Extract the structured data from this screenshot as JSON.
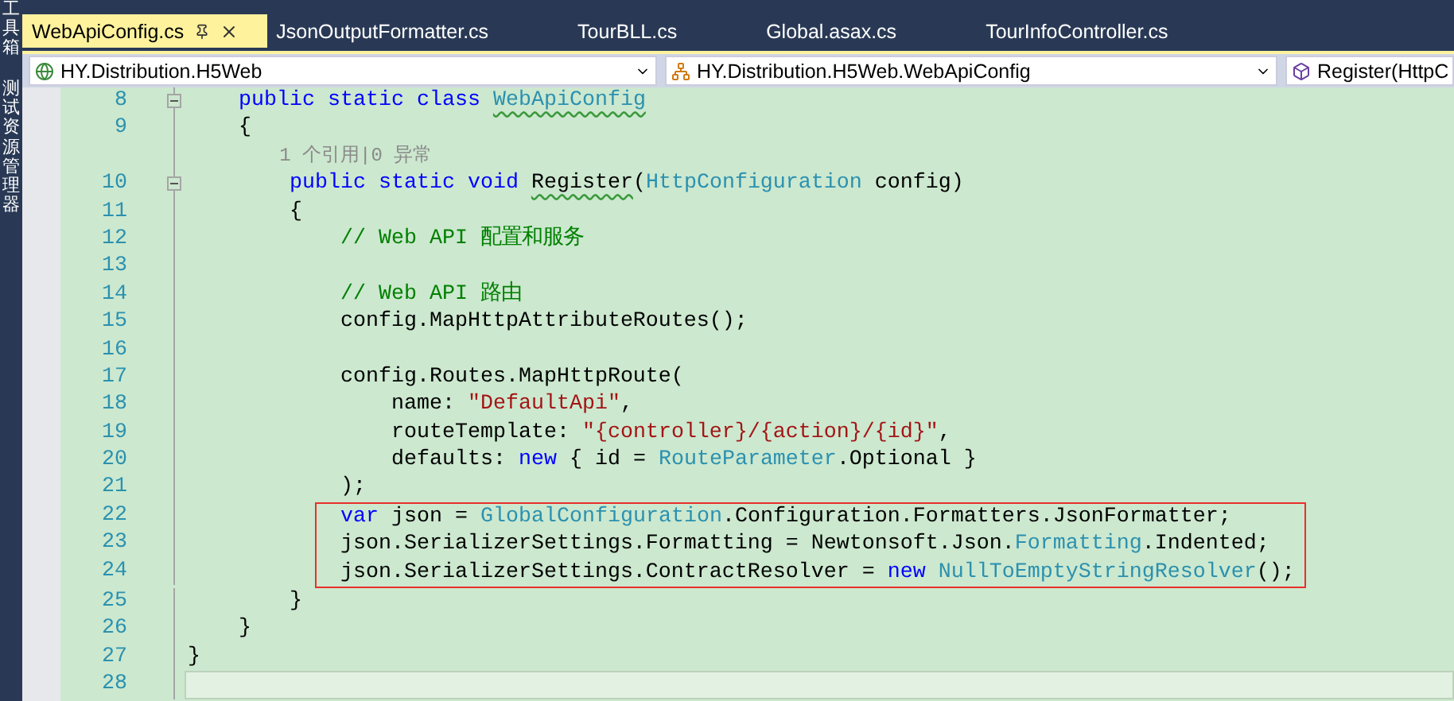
{
  "side_panel": {
    "tabs": [
      {
        "label": "工具箱"
      },
      {
        "label": "测试资源管理器"
      }
    ]
  },
  "tabs": [
    {
      "label": "WebApiConfig.cs",
      "selected": true
    },
    {
      "label": "JsonOutputFormatter.cs",
      "selected": false
    },
    {
      "label": "TourBLL.cs",
      "selected": false
    },
    {
      "label": "Global.asax.cs",
      "selected": false
    },
    {
      "label": "TourInfoController.cs",
      "selected": false
    }
  ],
  "navigation_bar": {
    "project": "HY.Distribution.H5Web",
    "type": "HY.Distribution.H5Web.WebApiConfig",
    "member": "Register(HttpC"
  },
  "editor": {
    "lines": [
      {
        "kind": "code",
        "number": "8",
        "foldable": true,
        "highlighted": false,
        "tokens": [
          {
            "kind": "keyword",
            "text": "    public static class "
          },
          {
            "kind": "type",
            "text": "WebApiConfig",
            "squiggly": true
          }
        ]
      },
      {
        "kind": "code",
        "number": "9",
        "foldable": false,
        "highlighted": false,
        "tokens": [
          {
            "kind": "plain",
            "text": "    {"
          }
        ]
      },
      {
        "kind": "codelens",
        "text": "        1 个引用|0 异常"
      },
      {
        "kind": "code",
        "number": "10",
        "foldable": true,
        "highlighted": false,
        "tokens": [
          {
            "kind": "keyword",
            "text": "        public static void "
          },
          {
            "kind": "plain",
            "text": "Register",
            "squiggly": true
          },
          {
            "kind": "plain",
            "text": "("
          },
          {
            "kind": "type",
            "text": "HttpConfiguration"
          },
          {
            "kind": "plain",
            "text": " config)"
          }
        ]
      },
      {
        "kind": "code",
        "number": "11",
        "foldable": false,
        "highlighted": false,
        "tokens": [
          {
            "kind": "plain",
            "text": "        {"
          }
        ]
      },
      {
        "kind": "code",
        "number": "12",
        "foldable": false,
        "highlighted": false,
        "tokens": [
          {
            "kind": "comment",
            "text": "            // Web API 配置和服务"
          }
        ]
      },
      {
        "kind": "code",
        "number": "13",
        "foldable": false,
        "highlighted": false
      },
      {
        "kind": "code",
        "number": "14",
        "foldable": false,
        "highlighted": false,
        "tokens": [
          {
            "kind": "comment",
            "text": "            // Web API 路由"
          }
        ]
      },
      {
        "kind": "code",
        "number": "15",
        "foldable": false,
        "highlighted": false,
        "tokens": [
          {
            "kind": "plain",
            "text": "            config.MapHttpAttributeRoutes();"
          }
        ]
      },
      {
        "kind": "code",
        "number": "16",
        "foldable": false,
        "highlighted": false
      },
      {
        "kind": "code",
        "number": "17",
        "foldable": false,
        "highlighted": false,
        "tokens": [
          {
            "kind": "plain",
            "text": "            config.Routes.MapHttpRoute("
          }
        ]
      },
      {
        "kind": "code",
        "number": "18",
        "foldable": false,
        "highlighted": false,
        "tokens": [
          {
            "kind": "plain",
            "text": "                name: "
          },
          {
            "kind": "string",
            "text": "\"DefaultApi\""
          },
          {
            "kind": "plain",
            "text": ","
          }
        ]
      },
      {
        "kind": "code",
        "number": "19",
        "foldable": false,
        "highlighted": false,
        "tokens": [
          {
            "kind": "plain",
            "text": "                routeTemplate: "
          },
          {
            "kind": "string",
            "text": "\"{controller}/{action}/{id}\""
          },
          {
            "kind": "plain",
            "text": ","
          }
        ]
      },
      {
        "kind": "code",
        "number": "20",
        "foldable": false,
        "highlighted": false,
        "tokens": [
          {
            "kind": "plain",
            "text": "                defaults: "
          },
          {
            "kind": "keyword",
            "text": "new"
          },
          {
            "kind": "plain",
            "text": " { id = "
          },
          {
            "kind": "type",
            "text": "RouteParameter"
          },
          {
            "kind": "plain",
            "text": ".Optional }"
          }
        ]
      },
      {
        "kind": "code",
        "number": "21",
        "foldable": false,
        "highlighted": false,
        "tokens": [
          {
            "kind": "plain",
            "text": "            );"
          }
        ]
      },
      {
        "kind": "code",
        "number": "22",
        "foldable": false,
        "highlighted": true,
        "tokens": [
          {
            "kind": "keyword",
            "text": "            var"
          },
          {
            "kind": "plain",
            "text": " json = "
          },
          {
            "kind": "type",
            "text": "GlobalConfiguration"
          },
          {
            "kind": "plain",
            "text": ".Configuration.Formatters.JsonFormatter;"
          }
        ]
      },
      {
        "kind": "code",
        "number": "23",
        "foldable": false,
        "highlighted": true,
        "tokens": [
          {
            "kind": "plain",
            "text": "            json.SerializerSettings.Formatting = Newtonsoft.Json."
          },
          {
            "kind": "type",
            "text": "Formatting"
          },
          {
            "kind": "plain",
            "text": ".Indented;"
          }
        ]
      },
      {
        "kind": "code",
        "number": "24",
        "foldable": false,
        "highlighted": true,
        "tokens": [
          {
            "kind": "plain",
            "text": "            json.SerializerSettings.ContractResolver = "
          },
          {
            "kind": "keyword",
            "text": "new"
          },
          {
            "kind": "type",
            "text": " NullToEmptyStringResolver"
          },
          {
            "kind": "plain",
            "text": "();"
          }
        ]
      },
      {
        "kind": "code",
        "number": "25",
        "foldable": false,
        "highlighted": false,
        "tokens": [
          {
            "kind": "plain",
            "text": "        }"
          }
        ]
      },
      {
        "kind": "code",
        "number": "26",
        "foldable": false,
        "highlighted": false,
        "tokens": [
          {
            "kind": "plain",
            "text": "    }"
          }
        ]
      },
      {
        "kind": "code",
        "number": "27",
        "foldable": false,
        "highlighted": false,
        "tokens": [
          {
            "kind": "plain",
            "text": "}"
          }
        ]
      },
      {
        "kind": "code",
        "number": "28",
        "foldable": false,
        "highlighted": false,
        "current": true
      }
    ]
  }
}
